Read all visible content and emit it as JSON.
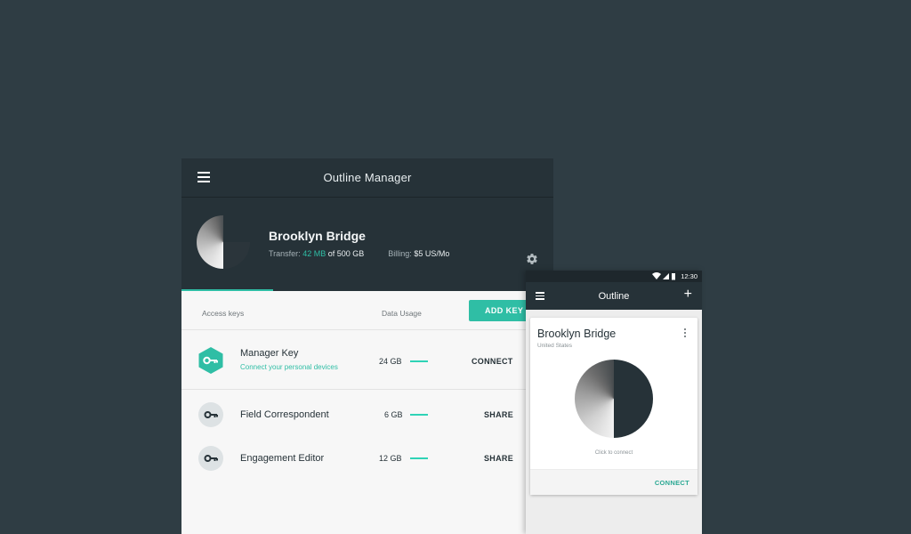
{
  "manager": {
    "title": "Outline Manager",
    "server": {
      "name": "Brooklyn Bridge",
      "transfer_label": "Transfer:",
      "transfer_used": "42 MB",
      "transfer_of": "of 500 GB",
      "billing_label": "Billing:",
      "billing_value": "$5 US/Mo"
    },
    "columns": {
      "access_keys": "Access keys",
      "data_usage": "Data Usage"
    },
    "add_key_label": "ADD KEY",
    "keys": [
      {
        "name": "Manager Key",
        "subtitle": "Connect your personal devices",
        "usage": "24 GB",
        "action": "CONNECT"
      },
      {
        "name": "Field Correspondent",
        "usage": "6 GB",
        "action": "SHARE"
      },
      {
        "name": "Engagement Editor",
        "usage": "12 GB",
        "action": "SHARE"
      }
    ]
  },
  "phone": {
    "status_time": "12:30",
    "app_title": "Outline",
    "add_symbol": "+",
    "server": {
      "name": "Brooklyn Bridge",
      "location": "United States",
      "hint": "Click to connect",
      "connect_label": "CONNECT"
    }
  },
  "colors": {
    "background": "#2f3d44",
    "header": "#263238",
    "accent": "#2fbea5",
    "usage_bar": "#2fd3b6"
  },
  "icons": [
    "menu-icon",
    "gear-icon",
    "key-icon",
    "wifi-icon",
    "signal-icon",
    "battery-icon",
    "plus-icon",
    "more-vert-icon"
  ]
}
